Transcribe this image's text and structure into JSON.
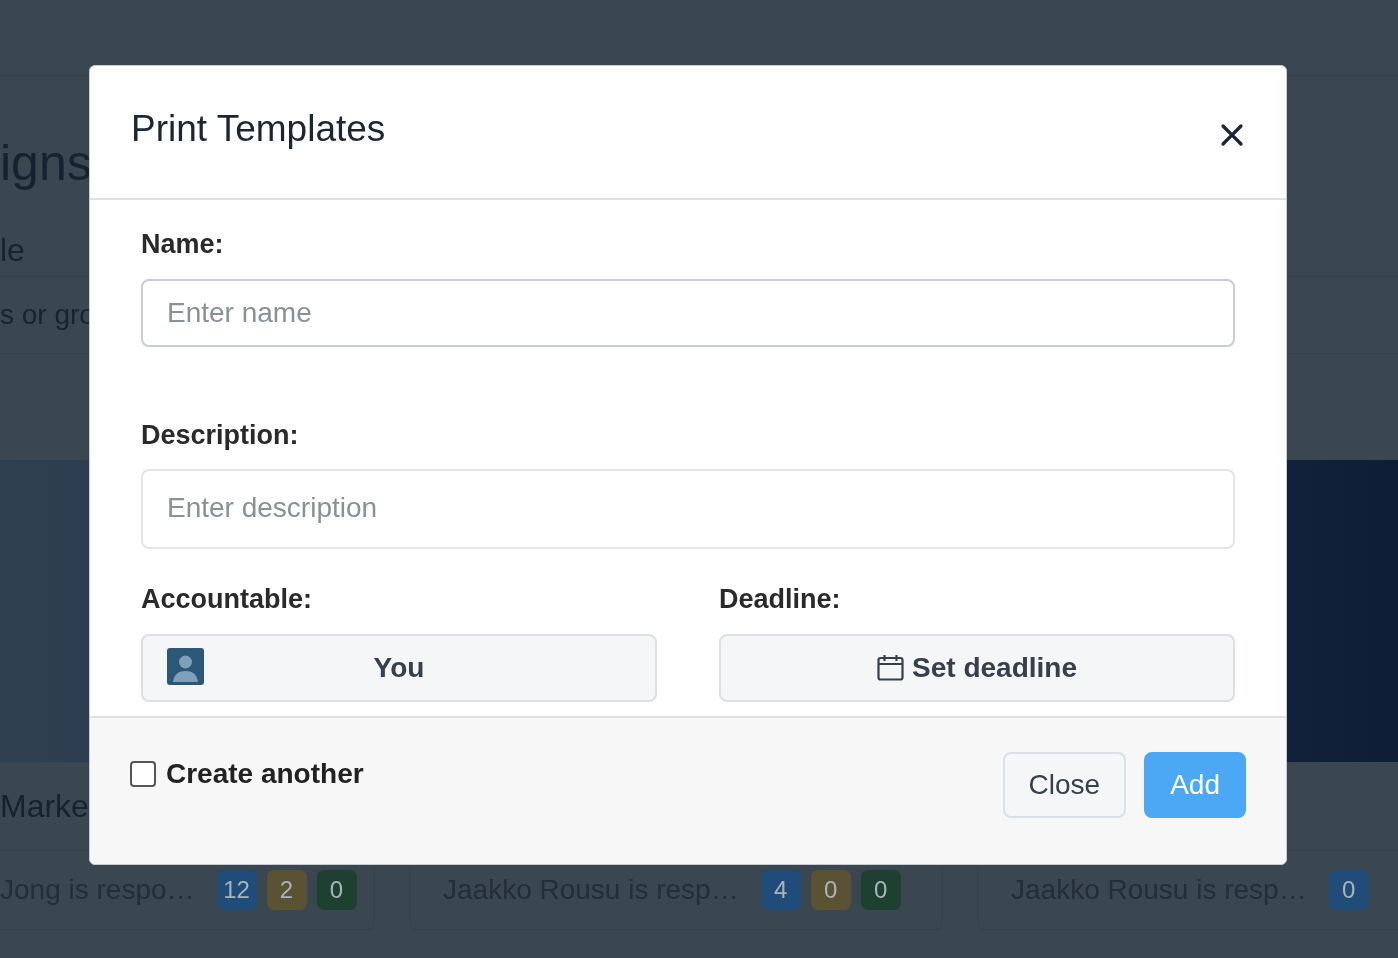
{
  "background": {
    "heading": "igns",
    "subheading": "le",
    "filter_text": "s or gro",
    "section_title": "Marke",
    "cards": [
      {
        "text": "Jong is respo…",
        "counts": [
          {
            "value": "12",
            "color": "#1f4c78"
          },
          {
            "value": "2",
            "color": "#5b5233"
          },
          {
            "value": "0",
            "color": "#1d4030"
          }
        ]
      },
      {
        "text": "Jaakko Rousu is resp…",
        "counts": [
          {
            "value": "4",
            "color": "#1f4c78"
          },
          {
            "value": "0",
            "color": "#5b5233"
          },
          {
            "value": "0",
            "color": "#1d4030"
          }
        ]
      },
      {
        "text": "Jaakko Rousu is resp…",
        "counts": [
          {
            "value": "0",
            "color": "#1f4c78"
          }
        ]
      }
    ]
  },
  "modal": {
    "title": "Print Templates",
    "fields": [
      {
        "kind": "text",
        "label": "Name:",
        "placeholder": "Enter name"
      },
      {
        "kind": "textarea",
        "label": "Description:",
        "placeholder": "Enter description"
      }
    ],
    "accountable": {
      "label": "Accountable:",
      "value": "You"
    },
    "deadline": {
      "label": "Deadline:",
      "button": "Set deadline"
    },
    "create_another": {
      "label": "Create another",
      "checked": false
    },
    "buttons": [
      {
        "label": "Close",
        "kind": "secondary"
      },
      {
        "label": "Add",
        "kind": "primary"
      }
    ]
  }
}
